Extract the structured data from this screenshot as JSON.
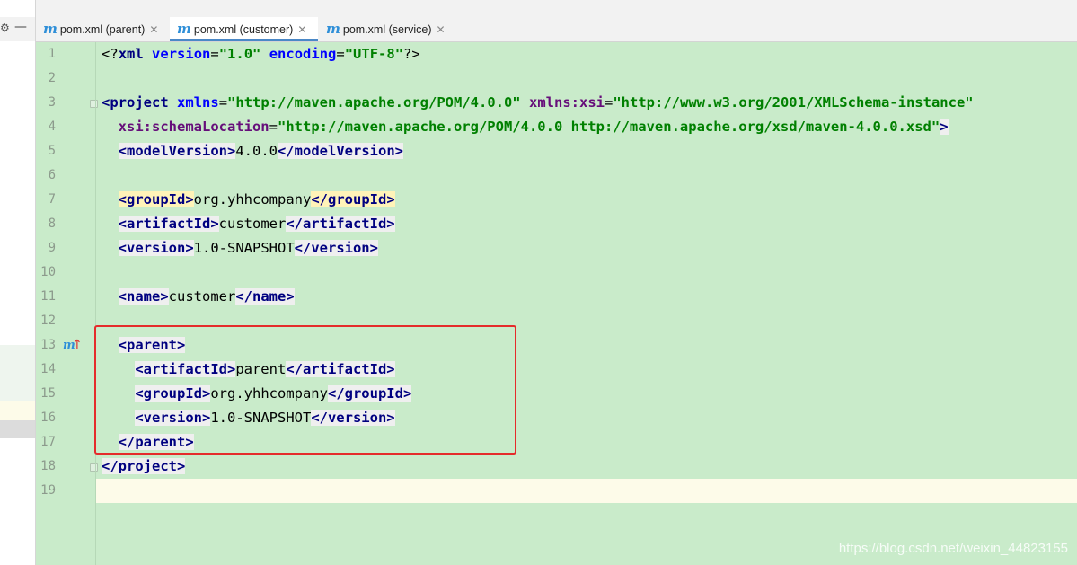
{
  "tabs": [
    {
      "icon": "m",
      "label": "pom.xml (parent)",
      "active": false
    },
    {
      "icon": "m",
      "label": "pom.xml (customer)",
      "active": true
    },
    {
      "icon": "m",
      "label": "pom.xml (service)",
      "active": false
    }
  ],
  "left_panel": {
    "gear_icon": "⚙",
    "minimize_icon": "—"
  },
  "gutter": {
    "line_numbers": [
      "1",
      "2",
      "3",
      "4",
      "5",
      "6",
      "7",
      "8",
      "9",
      "10",
      "11",
      "12",
      "13",
      "14",
      "15",
      "16",
      "17",
      "18",
      "19"
    ],
    "marker_m": "m",
    "marker_arrow": "↑"
  },
  "code": {
    "l1": {
      "open": "<",
      "q": "?",
      "name": "xml",
      "a1": "version",
      "eq1": "=",
      "v1": "\"1.0\"",
      "a2": "encoding",
      "eq2": "=",
      "v2": "\"UTF-8\"",
      "close": "?>"
    },
    "l3": {
      "lt": "<",
      "tag": "project",
      "a1": "xmlns",
      "eq1": "=",
      "v1": "\"http://maven.apache.org/POM/4.0.0\"",
      "ns": "xmlns:xsi",
      "eq2": "=",
      "v2": "\"http://www.w3.org/2001/XMLSchema-instance\""
    },
    "l4": {
      "ns": "xsi:schemaLocation",
      "eq": "=",
      "v": "\"http://maven.apache.org/POM/4.0.0 http://maven.apache.org/xsd/maven-4.0.0.xsd\"",
      "gt": ">"
    },
    "l5": {
      "open": "<modelVersion>",
      "text": "4.0.0",
      "close": "</modelVersion>"
    },
    "l7": {
      "open": "<groupId>",
      "text": "org.yhhcompany",
      "close": "</groupId>"
    },
    "l8": {
      "open": "<artifactId>",
      "text": "customer",
      "close": "</artifactId>"
    },
    "l9": {
      "open": "<version>",
      "text": "1.0-SNAPSHOT",
      "close": "</version>"
    },
    "l11": {
      "open": "<name>",
      "text": "customer",
      "close": "</name>"
    },
    "l13": {
      "open": "<parent>"
    },
    "l14": {
      "open": "<artifactId>",
      "text": "parent",
      "close": "</artifactId>"
    },
    "l15": {
      "open": "<groupId>",
      "text": "org.yhhcompany",
      "close": "</groupId>"
    },
    "l16": {
      "open": "<version>",
      "text": "1.0-SNAPSHOT",
      "close": "</version>"
    },
    "l17": {
      "close": "</parent>"
    },
    "l18": {
      "close": "</project>"
    }
  },
  "watermark": "https://blog.csdn.net/weixin_44823155",
  "colors": {
    "editor_bg": "#c9ebca",
    "tag": "#000080",
    "value": "#008000",
    "attribute": "#0000ff",
    "highlight_box": "#e52b2b"
  }
}
